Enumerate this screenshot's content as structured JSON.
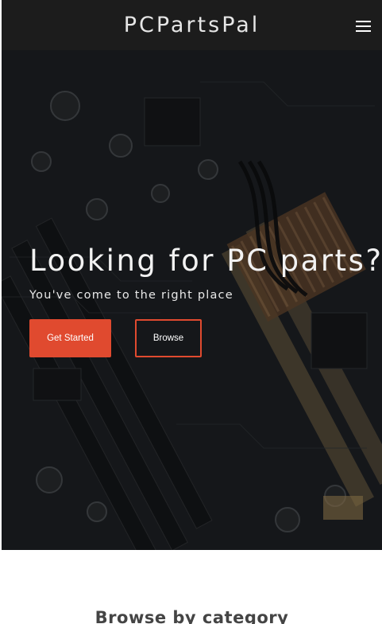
{
  "navbar": {
    "brand": "PCPartsPal",
    "menu_icon": "hamburger-menu-icon"
  },
  "hero": {
    "background": "motherboard-photo",
    "headline": "Looking for PC parts?",
    "subheadline": "You've come to the right place",
    "primary_button": "Get Started",
    "secondary_button": "Browse"
  },
  "section": {
    "title": "Browse by category"
  },
  "colors": {
    "navbar_bg": "#1c1c1c",
    "accent": "#e04a2f",
    "hero_text": "#f2f2f2",
    "section_title": "#444444"
  }
}
